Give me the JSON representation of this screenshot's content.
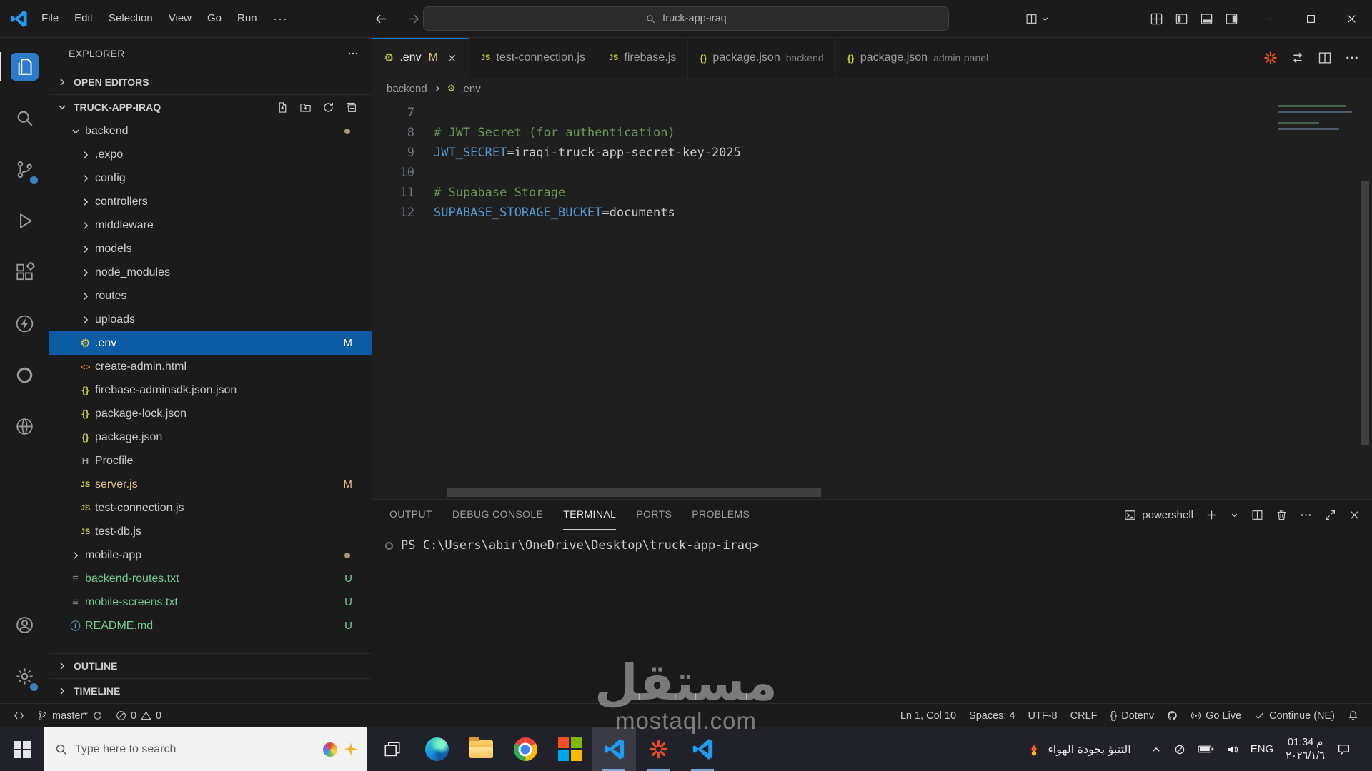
{
  "window": {
    "title_search": "truck-app-iraq",
    "menus": [
      "File",
      "Edit",
      "Selection",
      "View",
      "Go",
      "Run"
    ]
  },
  "activity_bar": {
    "top": [
      {
        "name": "explorer",
        "active": true
      },
      {
        "name": "search",
        "active": false
      },
      {
        "name": "source-control",
        "active": false,
        "badge": true
      },
      {
        "name": "run-debug",
        "active": false
      },
      {
        "name": "extensions",
        "active": false
      },
      {
        "name": "thunder-client",
        "active": false
      },
      {
        "name": "ring",
        "active": false
      },
      {
        "name": "globe",
        "active": false
      }
    ],
    "bottom": [
      {
        "name": "account",
        "active": false
      },
      {
        "name": "settings",
        "active": false,
        "badge": true
      }
    ]
  },
  "sidebar": {
    "header": "EXPLORER",
    "open_editors": "OPEN EDITORS",
    "project": "TRUCK-APP-IRAQ",
    "outline": "OUTLINE",
    "timeline": "TIMELINE",
    "tree": [
      {
        "label": "backend",
        "kind": "folder",
        "depth": 0,
        "expanded": true,
        "badge": "dot"
      },
      {
        "label": ".expo",
        "kind": "folder",
        "depth": 1
      },
      {
        "label": "config",
        "kind": "folder",
        "depth": 1
      },
      {
        "label": "controllers",
        "kind": "folder",
        "depth": 1
      },
      {
        "label": "middleware",
        "kind": "folder",
        "depth": 1
      },
      {
        "label": "models",
        "kind": "folder",
        "depth": 1
      },
      {
        "label": "node_modules",
        "kind": "folder",
        "depth": 1
      },
      {
        "label": "routes",
        "kind": "folder",
        "depth": 1
      },
      {
        "label": "uploads",
        "kind": "folder",
        "depth": 1
      },
      {
        "label": ".env",
        "kind": "file",
        "icon": "gear",
        "depth": 1,
        "selected": true,
        "badge": "M",
        "color": "modified"
      },
      {
        "label": "create-admin.html",
        "kind": "file",
        "icon": "html",
        "depth": 1
      },
      {
        "label": "firebase-adminsdk.json.json",
        "kind": "file",
        "icon": "json",
        "depth": 1
      },
      {
        "label": "package-lock.json",
        "kind": "file",
        "icon": "json",
        "depth": 1
      },
      {
        "label": "package.json",
        "kind": "file",
        "icon": "json",
        "depth": 1
      },
      {
        "label": "Procfile",
        "kind": "file",
        "icon": "heroku",
        "depth": 1
      },
      {
        "label": "server.js",
        "kind": "file",
        "icon": "js",
        "depth": 1,
        "badge": "M",
        "color": "modified"
      },
      {
        "label": "test-connection.js",
        "kind": "file",
        "icon": "js",
        "depth": 1
      },
      {
        "label": "test-db.js",
        "kind": "file",
        "icon": "js",
        "depth": 1
      },
      {
        "label": "mobile-app",
        "kind": "folder",
        "depth": 0,
        "badge": "dot"
      },
      {
        "label": "backend-routes.txt",
        "kind": "file",
        "icon": "txt",
        "depth": 0,
        "badge": "U",
        "color": "untracked"
      },
      {
        "label": "mobile-screens.txt",
        "kind": "file",
        "icon": "txt",
        "depth": 0,
        "badge": "U",
        "color": "untracked"
      },
      {
        "label": "README.md",
        "kind": "file",
        "icon": "info",
        "depth": 0,
        "badge": "U",
        "color": "untracked"
      }
    ]
  },
  "editor": {
    "tabs": [
      {
        "label": ".env",
        "icon": "gear",
        "active": true,
        "modified": "M"
      },
      {
        "label": "test-connection.js",
        "icon": "js"
      },
      {
        "label": "firebase.js",
        "icon": "js"
      },
      {
        "label": "package.json",
        "icon": "json",
        "suffix": "backend"
      },
      {
        "label": "package.json",
        "icon": "json",
        "suffix": "admin-panel"
      }
    ],
    "breadcrumb": {
      "folder": "backend",
      "file": ".env"
    },
    "lines": [
      {
        "num": "7",
        "tokens": []
      },
      {
        "num": "8",
        "tokens": [
          {
            "t": "# JWT Secret (for authentication)",
            "c": "comment"
          }
        ]
      },
      {
        "num": "9",
        "tokens": [
          {
            "t": "JWT_SECRET",
            "c": "key"
          },
          {
            "t": "=iraqi-truck-app-secret-key-2025",
            "c": "value"
          }
        ]
      },
      {
        "num": "10",
        "tokens": []
      },
      {
        "num": "11",
        "tokens": [
          {
            "t": "# Supabase Storage",
            "c": "comment"
          }
        ]
      },
      {
        "num": "12",
        "tokens": [
          {
            "t": "SUPABASE_STORAGE_BUCKET",
            "c": "key"
          },
          {
            "t": "=documents",
            "c": "value"
          }
        ]
      }
    ]
  },
  "panel": {
    "tabs": [
      {
        "label": "OUTPUT"
      },
      {
        "label": "DEBUG CONSOLE"
      },
      {
        "label": "TERMINAL",
        "active": true
      },
      {
        "label": "PORTS"
      },
      {
        "label": "PROBLEMS"
      }
    ],
    "shell": "powershell",
    "prompt": "PS C:\\Users\\abir\\OneDrive\\Desktop\\truck-app-iraq>"
  },
  "statusbar": {
    "branch": "master*",
    "errors": "0",
    "warnings": "0",
    "cursor": "Ln 1, Col 10",
    "indent": "Spaces: 4",
    "encoding": "UTF-8",
    "eol": "CRLF",
    "language_icon": "{}",
    "language": "Dotenv",
    "go_live": "Go Live",
    "continue_label": "Continue (NE)"
  },
  "taskbar": {
    "search_placeholder": "Type here to search",
    "apps": [
      {
        "name": "task-view"
      },
      {
        "name": "edge"
      },
      {
        "name": "file-explorer"
      },
      {
        "name": "chrome"
      },
      {
        "name": "microsoft"
      },
      {
        "name": "vscode",
        "state": "active"
      },
      {
        "name": "augment",
        "state": "open"
      },
      {
        "name": "vscode-2",
        "state": "open"
      }
    ],
    "weather": "التنبؤ بجودة الهواء",
    "language": "ENG",
    "time": "01:34 م",
    "date": "٢٠٢٦/١/٦"
  },
  "watermark": {
    "line1": "مستقل",
    "line2": "mostaql.com"
  }
}
